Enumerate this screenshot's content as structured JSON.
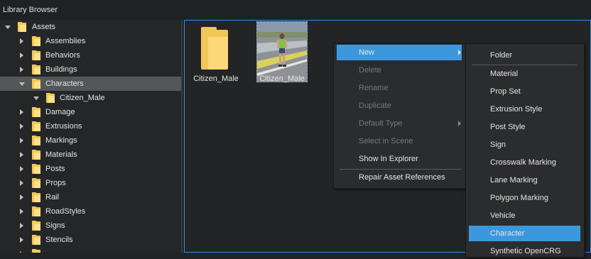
{
  "window": {
    "title": "Library Browser"
  },
  "tree": {
    "root": "Assets",
    "items": [
      {
        "label": "Assemblies"
      },
      {
        "label": "Behaviors"
      },
      {
        "label": "Buildings"
      },
      {
        "label": "Characters"
      },
      {
        "label": "Citizen_Male"
      },
      {
        "label": "Damage"
      },
      {
        "label": "Extrusions"
      },
      {
        "label": "Markings"
      },
      {
        "label": "Materials"
      },
      {
        "label": "Posts"
      },
      {
        "label": "Props"
      },
      {
        "label": "Rail"
      },
      {
        "label": "RoadStyles"
      },
      {
        "label": "Signs"
      },
      {
        "label": "Stencils"
      }
    ]
  },
  "content": {
    "items": [
      {
        "label": "Citizen_Male",
        "kind": "folder-icon"
      },
      {
        "label": "Citizen_Male",
        "kind": "character-thumbnail"
      }
    ]
  },
  "context_menu": {
    "items": [
      {
        "label": "New"
      },
      {
        "label": "Delete"
      },
      {
        "label": "Rename"
      },
      {
        "label": "Duplicate"
      },
      {
        "label": "Default Type"
      },
      {
        "label": "Select in Scene"
      },
      {
        "label": "Show In Explorer"
      },
      {
        "label": "Repair Asset References"
      }
    ]
  },
  "submenu": {
    "items": [
      {
        "label": "Folder"
      },
      {
        "label": "Material"
      },
      {
        "label": "Prop Set"
      },
      {
        "label": "Extrusion Style"
      },
      {
        "label": "Post Style"
      },
      {
        "label": "Sign"
      },
      {
        "label": "Crosswalk Marking"
      },
      {
        "label": "Lane Marking"
      },
      {
        "label": "Polygon Marking"
      },
      {
        "label": "Vehicle"
      },
      {
        "label": "Character"
      },
      {
        "label": "Synthetic OpenCRG"
      }
    ]
  },
  "colors": {
    "accent": "#3c98dc",
    "folder": "#f5c94c",
    "selection": "#54575a"
  }
}
